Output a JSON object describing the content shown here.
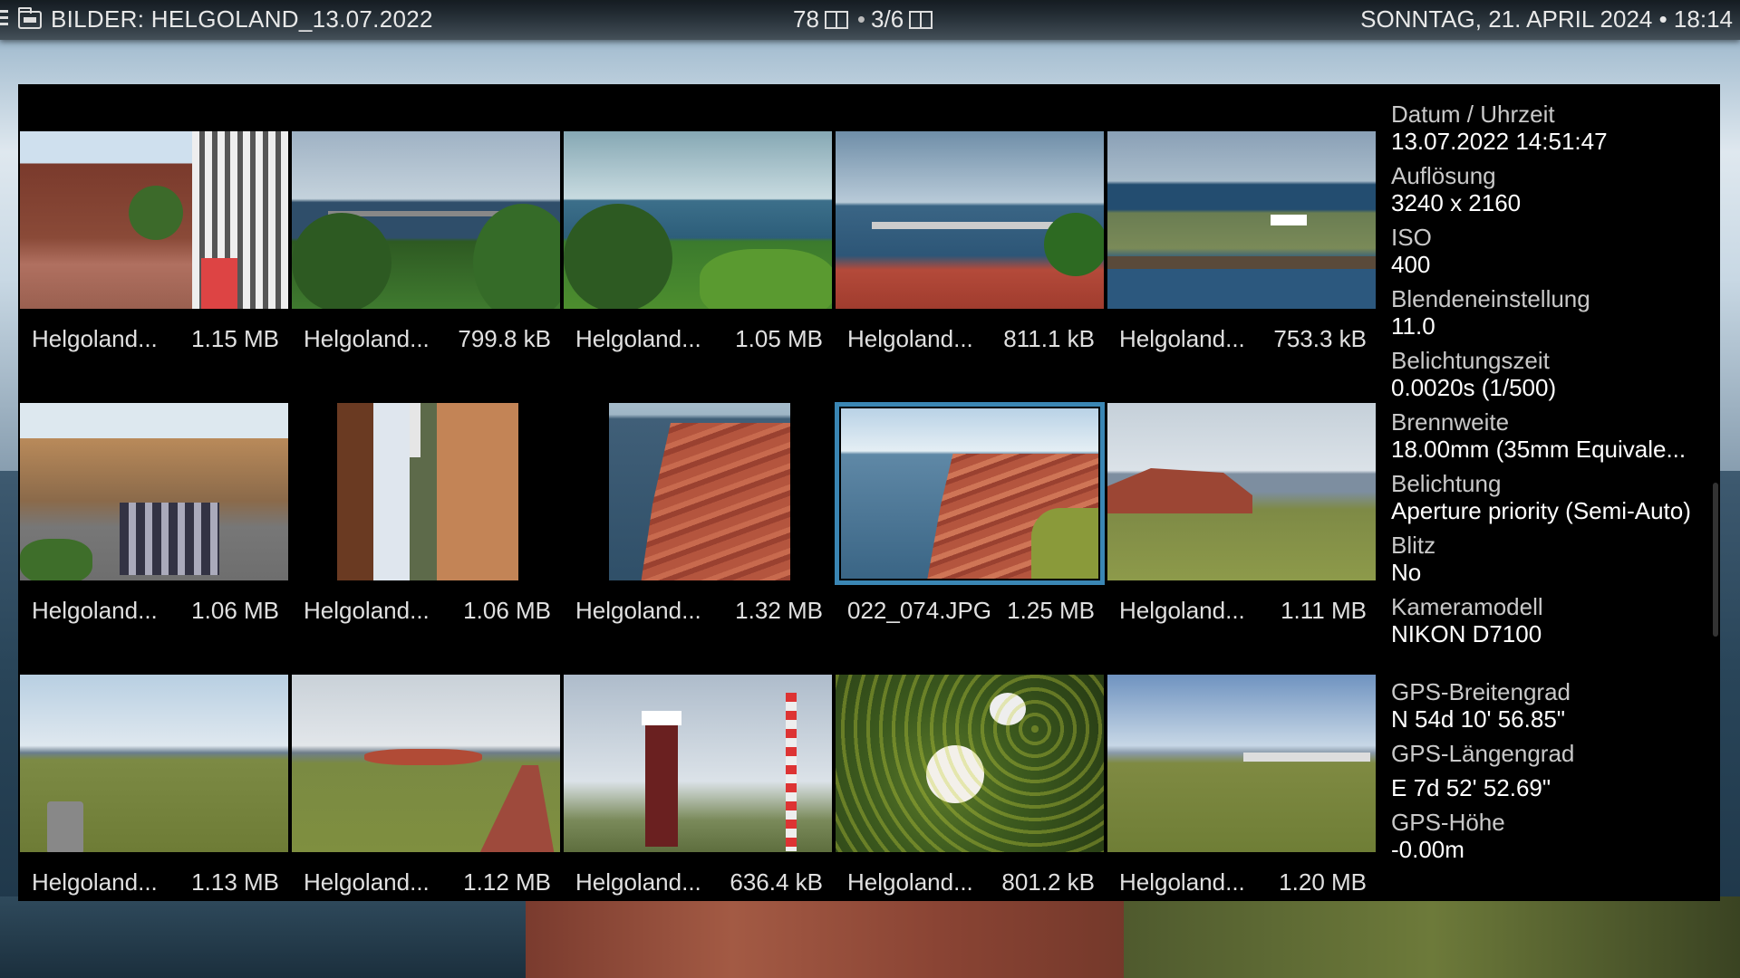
{
  "header": {
    "title": "BILDER: HELGOLAND_13.07.2022",
    "count": "78",
    "page": "3/6",
    "datetime": "SONNTAG, 21. APRIL 2024 • 18:14"
  },
  "tiles": [
    {
      "name": "Helgoland...",
      "size": "1.15 MB",
      "scene": "street"
    },
    {
      "name": "Helgoland...",
      "size": "799.8 kB",
      "scene": "coast-bushes"
    },
    {
      "name": "Helgoland...",
      "size": "1.05 MB",
      "scene": "sea-bushes"
    },
    {
      "name": "Helgoland...",
      "size": "811.1 kB",
      "scene": "sea-railing"
    },
    {
      "name": "Helgoland...",
      "size": "753.3 kB",
      "scene": "harbor"
    },
    {
      "name": "Helgoland...",
      "size": "1.06 MB",
      "scene": "street-crowd"
    },
    {
      "name": "Helgoland...",
      "size": "1.06 MB",
      "scene": "lighthouse-house"
    },
    {
      "name": "Helgoland...",
      "size": "1.32 MB",
      "scene": "cliff-portrait"
    },
    {
      "name": "022_074.JPG",
      "size": "1.25 MB",
      "scene": "cliff",
      "selected": true
    },
    {
      "name": "Helgoland...",
      "size": "1.11 MB",
      "scene": "cliff-meadow"
    },
    {
      "name": "Helgoland...",
      "size": "1.13 MB",
      "scene": "meadow-bin"
    },
    {
      "name": "Helgoland...",
      "size": "1.12 MB",
      "scene": "path"
    },
    {
      "name": "Helgoland...",
      "size": "636.4 kB",
      "scene": "lighthouse"
    },
    {
      "name": "Helgoland...",
      "size": "801.2 kB",
      "scene": "flower"
    },
    {
      "name": "Helgoland...",
      "size": "1.20 MB",
      "scene": "meadow-sky"
    }
  ],
  "info": [
    {
      "label": "Datum / Uhrzeit",
      "value": "13.07.2022 14:51:47"
    },
    {
      "label": "Auflösung",
      "value": "3240 x 2160"
    },
    {
      "label": "ISO",
      "value": "400"
    },
    {
      "label": "Blendeneinstellung",
      "value": "11.0"
    },
    {
      "label": "Belichtungszeit",
      "value": "0.0020s (1/500)"
    },
    {
      "label": "Brennweite",
      "value": "18.00mm  (35mm Equivale..."
    },
    {
      "label": "Belichtung",
      "value": "Aperture priority (Semi-Auto)"
    },
    {
      "label": "Blitz",
      "value": "No"
    },
    {
      "label": "Kameramodell",
      "value": "NIKON D7100"
    },
    {
      "label": "GPS-Breitengrad",
      "value": "N 54d 10' 56.85\""
    },
    {
      "label": "GPS-Längengrad",
      "value": "E  7d 52' 52.69\""
    },
    {
      "label": "GPS-Höhe",
      "value": "-0.00m"
    }
  ]
}
